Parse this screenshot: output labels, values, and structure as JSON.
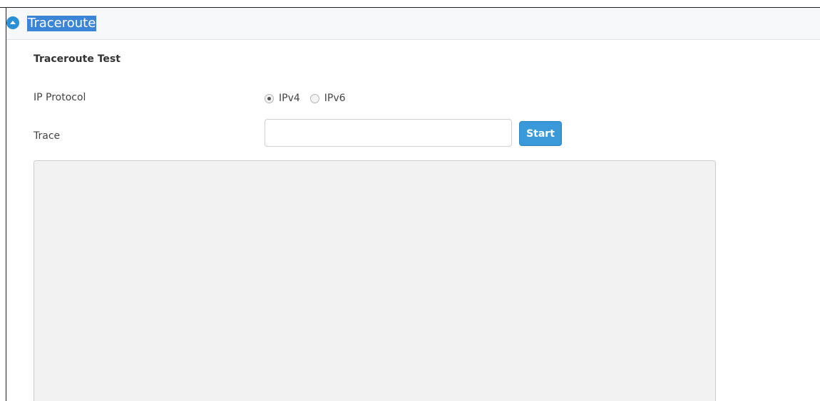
{
  "section": {
    "title": "Traceroute",
    "toggle_icon": "collapse-up-icon",
    "accent_color": "#2b8fd6",
    "title_highlight_color": "#3b84d6"
  },
  "form": {
    "subtitle": "Traceroute Test",
    "ip_protocol": {
      "label": "IP Protocol",
      "options": [
        {
          "label": "IPv4",
          "checked": true
        },
        {
          "label": "IPv6",
          "checked": false
        }
      ]
    },
    "trace": {
      "label": "Trace",
      "value": "",
      "placeholder": ""
    },
    "start_label": "Start",
    "start_button_color": "#3a9ad9"
  },
  "output": {
    "text": ""
  }
}
